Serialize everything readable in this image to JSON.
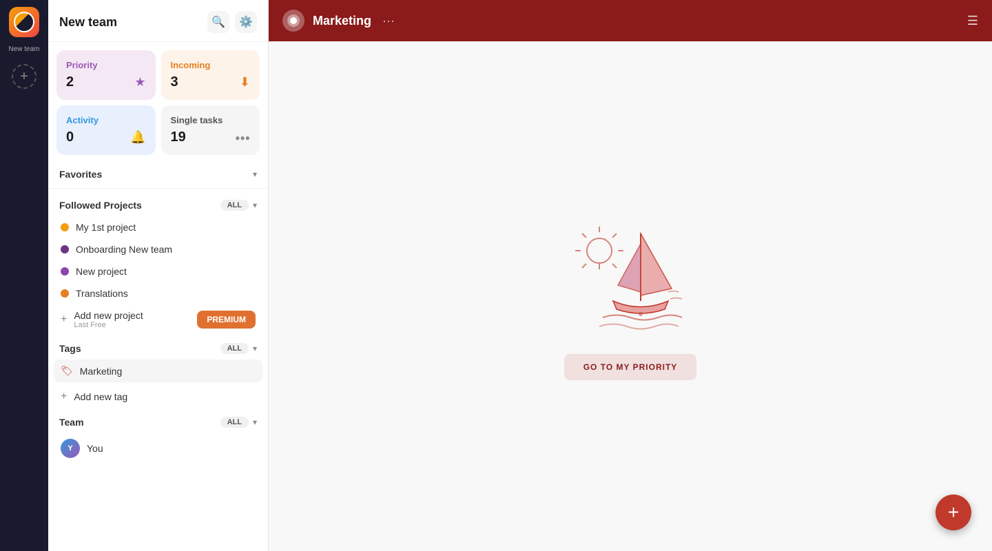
{
  "iconBar": {
    "teamLabel": "New team",
    "addLabel": "+"
  },
  "sidebar": {
    "title": "New team",
    "searchLabel": "Search",
    "settingsLabel": "Settings",
    "stats": {
      "priority": {
        "label": "Priority",
        "count": "2",
        "icon": "★"
      },
      "incoming": {
        "label": "Incoming",
        "count": "3",
        "icon": "⬇"
      },
      "activity": {
        "label": "Activity",
        "count": "0",
        "icon": "🔔"
      },
      "singleTasks": {
        "label": "Single tasks",
        "count": "19",
        "icon": "⬤⬤⬤"
      }
    },
    "favorites": {
      "title": "Favorites",
      "chevron": "▾"
    },
    "followedProjects": {
      "title": "Followed Projects",
      "allLabel": "ALL",
      "chevron": "▾",
      "projects": [
        {
          "name": "My 1st project",
          "color": "#f59e0b"
        },
        {
          "name": "Onboarding New team",
          "color": "#6c3483"
        },
        {
          "name": "New project",
          "color": "#8e44ad"
        },
        {
          "name": "Translations",
          "color": "#e67e22"
        }
      ],
      "addNew": {
        "label": "Add new project",
        "subLabel": "Last Free"
      },
      "premiumBtn": "PREMIUM"
    },
    "tags": {
      "title": "Tags",
      "allLabel": "ALL",
      "chevron": "▾",
      "items": [
        {
          "name": "Marketing",
          "icon": "🏷"
        }
      ],
      "addNew": "Add new tag"
    },
    "team": {
      "title": "Team",
      "allLabel": "ALL",
      "chevron": "▾",
      "members": [
        {
          "name": "You",
          "initials": "Y"
        }
      ]
    }
  },
  "main": {
    "header": {
      "title": "Marketing",
      "dotsLabel": "···"
    },
    "emptyState": {
      "buttonLabel": "GO TO MY PRIORITY"
    }
  },
  "fab": {
    "label": "+"
  }
}
